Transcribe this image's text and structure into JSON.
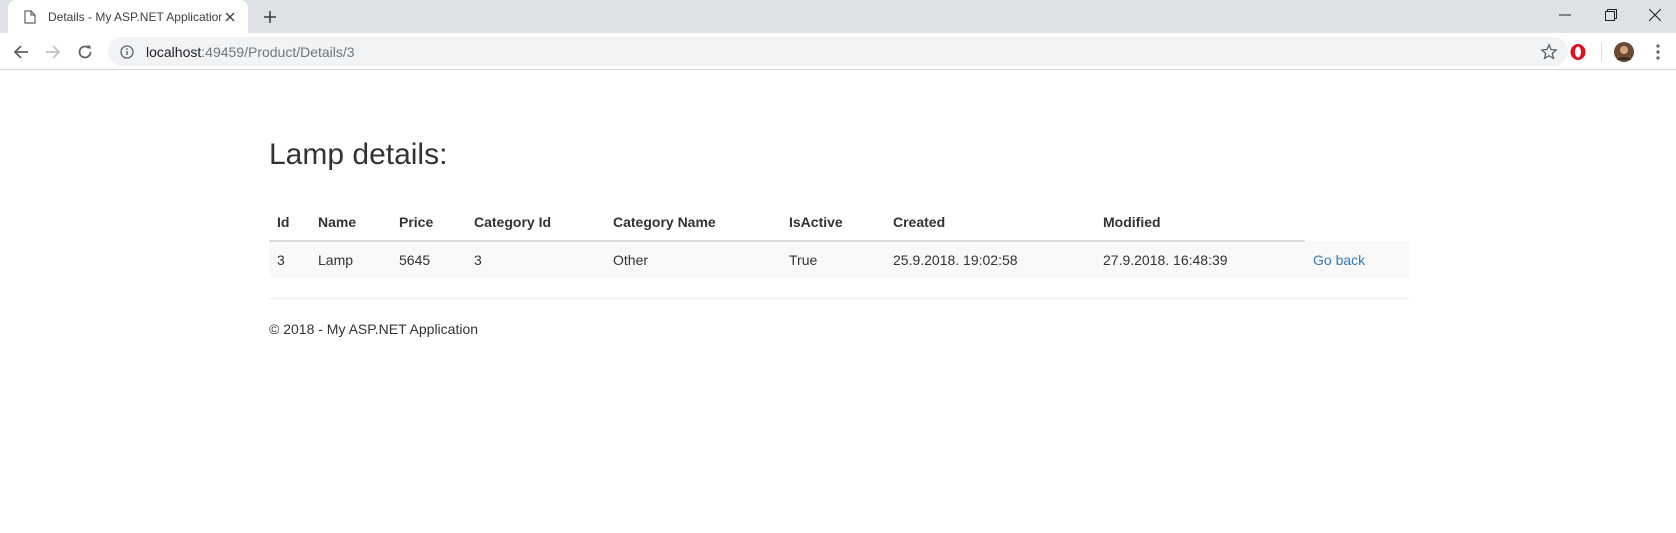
{
  "browser": {
    "tab_title": "Details - My ASP.NET Application",
    "url_host": "localhost",
    "url_path": ":49459/Product/Details/3"
  },
  "page": {
    "heading": "Lamp details:",
    "table": {
      "headers": [
        "Id",
        "Name",
        "Price",
        "Category Id",
        "Category Name",
        "IsActive",
        "Created",
        "Modified"
      ],
      "row": [
        "3",
        "Lamp",
        "5645",
        "3",
        "Other",
        "True",
        "25.9.2018. 19:02:58",
        "27.9.2018. 16:48:39"
      ],
      "action_label": "Go back"
    },
    "footer": "© 2018 - My ASP.NET Application"
  }
}
